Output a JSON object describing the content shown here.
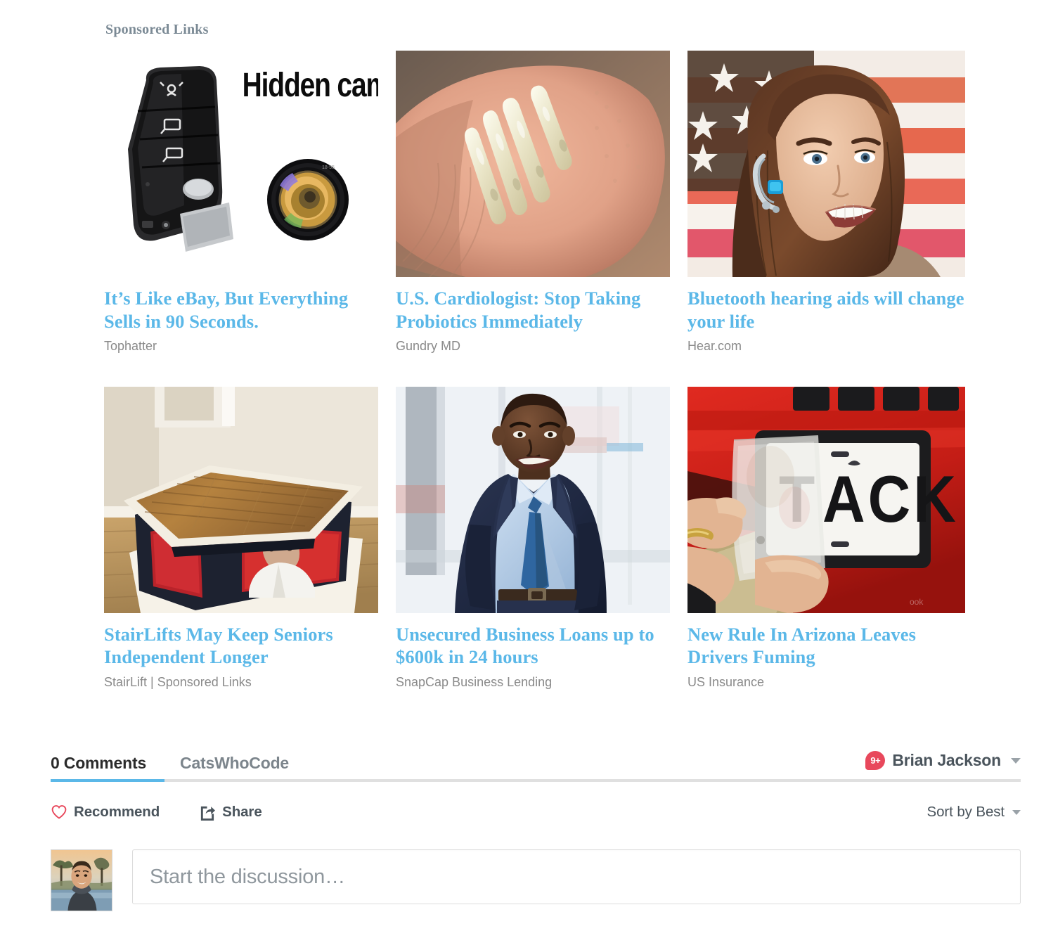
{
  "sponsored": {
    "heading": "Sponsored Links",
    "ads": [
      {
        "title": "It’s Like eBay, But Everything Sells in 90 Seconds.",
        "brand": "Tophatter",
        "image_alt": "Black car key fob hidden camera with camera lens and text Hidden camera",
        "image_overlay_text": "Hidden camera"
      },
      {
        "title": "U.S. Cardiologist: Stop Taking Probiotics Immediately",
        "brand": "Gundry MD",
        "image_alt": "Close-up of four small white grain-like objects on a fingertip"
      },
      {
        "title": "Bluetooth hearing aids will change your life",
        "brand": "Hear.com",
        "image_alt": "Smiling woman wearing a bluetooth hearing aid in front of an American flag"
      },
      {
        "title": "StairLifts May Keep Seniors Independent Longer",
        "brand": "StairLift | Sponsored Links",
        "image_alt": "Wooden-topped stairlift platform with red interior in a home"
      },
      {
        "title": "Unsecured Business Loans up to $600k in 24 hours",
        "brand": "SnapCap Business Lending",
        "image_alt": "Smiling businessman in a navy suit and blue tie in a bright office"
      },
      {
        "title": "New Rule In Arizona Leaves Drivers Fuming",
        "brand": "US Insurance",
        "image_alt": "Hands applying a cover over a license plate on a red vehicle",
        "image_plate_text": "ACK"
      }
    ]
  },
  "disqus": {
    "comment_count_label": "0 Comments",
    "site_name": "CatsWhoCode",
    "user": {
      "name": "Brian Jackson",
      "notification_badge": "9+",
      "dropdown_icon": "chevron-down-icon",
      "avatar_alt": "Profile photo of a smiling man outdoors at sunset"
    },
    "actions": {
      "recommend_label": "Recommend",
      "recommend_icon": "heart-icon",
      "share_label": "Share",
      "share_icon": "share-icon"
    },
    "sort": {
      "label": "Sort by Best",
      "icon": "chevron-down-icon"
    },
    "compose": {
      "placeholder": "Start the discussion…",
      "value": ""
    }
  },
  "colors": {
    "link_blue": "#5bb8e8",
    "heading_gray": "#7b8a95",
    "brand_gray": "#8a8a8a",
    "disqus_dark": "#2b2b2b",
    "disqus_gray": "#7c858c",
    "badge_red": "#e8485c",
    "active_tab_underline": "#5bb8e8"
  }
}
